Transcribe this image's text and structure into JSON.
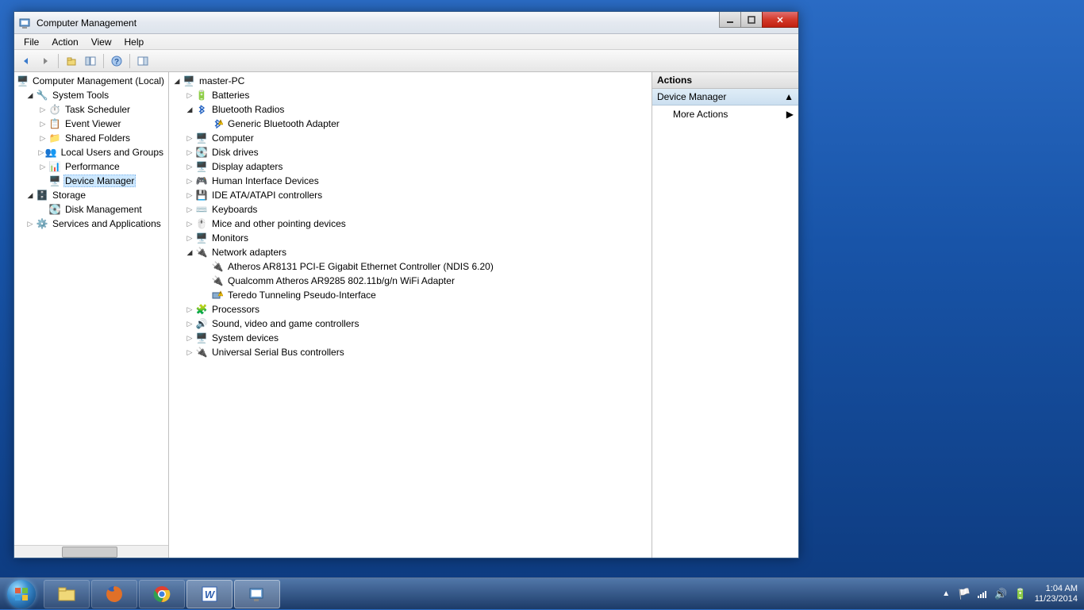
{
  "window": {
    "title": "Computer Management"
  },
  "menubar": [
    "File",
    "Action",
    "View",
    "Help"
  ],
  "left_tree": {
    "root": "Computer Management (Local)",
    "sys_tools": "System Tools",
    "task_sched": "Task Scheduler",
    "event_viewer": "Event Viewer",
    "shared": "Shared Folders",
    "local_users": "Local Users and Groups",
    "perf": "Performance",
    "devmgr": "Device Manager",
    "storage": "Storage",
    "diskmgmt": "Disk Management",
    "services": "Services and Applications"
  },
  "dev_tree": {
    "pc": "master-PC",
    "batteries": "Batteries",
    "bt": "Bluetooth Radios",
    "bt_generic": "Generic Bluetooth Adapter",
    "computer": "Computer",
    "disk": "Disk drives",
    "display": "Display adapters",
    "hid": "Human Interface Devices",
    "ide": "IDE ATA/ATAPI controllers",
    "kb": "Keyboards",
    "mice": "Mice and other pointing devices",
    "monitors": "Monitors",
    "net": "Network adapters",
    "net_ath": "Atheros AR8131 PCI-E Gigabit Ethernet Controller (NDIS 6.20)",
    "net_qc": "Qualcomm Atheros AR9285 802.11b/g/n WiFi Adapter",
    "net_teredo": "Teredo Tunneling Pseudo-Interface",
    "proc": "Processors",
    "sound": "Sound, video and game controllers",
    "sys": "System devices",
    "usb": "Universal Serial Bus controllers"
  },
  "actions": {
    "header": "Actions",
    "section": "Device Manager",
    "more": "More Actions"
  },
  "tray": {
    "time": "1:04 AM",
    "date": "11/23/2014"
  }
}
